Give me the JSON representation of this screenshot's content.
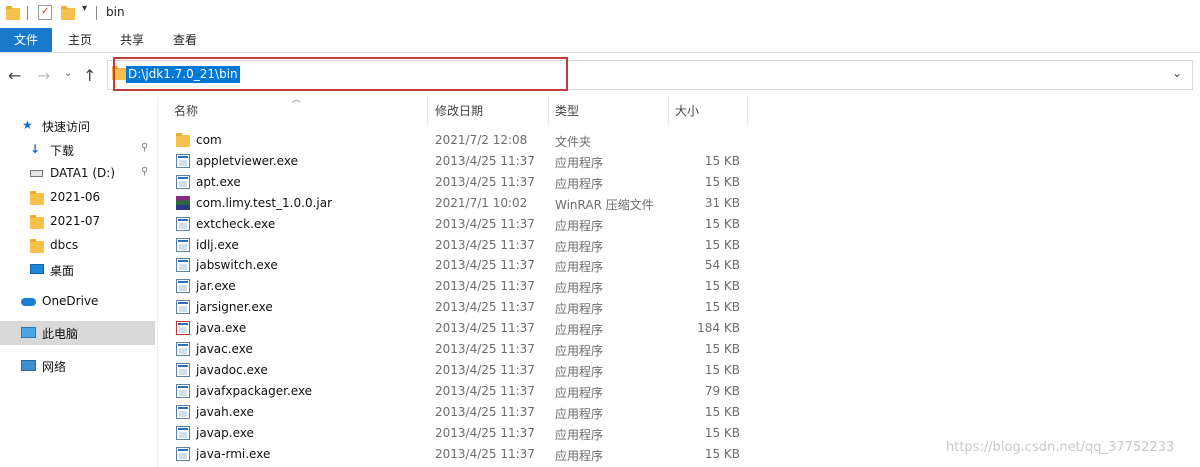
{
  "window": {
    "title": "bin"
  },
  "ribbon": {
    "tabs": [
      "文件",
      "主页",
      "共享",
      "查看"
    ]
  },
  "address": {
    "path": "D:\\jdk1.7.0_21\\bin"
  },
  "sidebar": {
    "items": [
      {
        "label": "快速访问",
        "icon": "star-icon"
      },
      {
        "label": "下载",
        "icon": "download-icon",
        "pinned": true
      },
      {
        "label": "DATA1 (D:)",
        "icon": "drive-icon",
        "pinned": true
      },
      {
        "label": "2021-06",
        "icon": "folder-icon"
      },
      {
        "label": "2021-07",
        "icon": "folder-icon"
      },
      {
        "label": "dbcs",
        "icon": "folder-icon"
      },
      {
        "label": "桌面",
        "icon": "desktop-icon"
      },
      {
        "label": "OneDrive",
        "icon": "cloud-icon"
      },
      {
        "label": "此电脑",
        "icon": "computer-icon",
        "selected": true
      },
      {
        "label": "网络",
        "icon": "network-icon"
      }
    ]
  },
  "columns": {
    "name": "名称",
    "date": "修改日期",
    "type": "类型",
    "size": "大小"
  },
  "files": [
    {
      "name": "com",
      "date": "2021/7/2 12:08",
      "type": "文件夹",
      "size": "",
      "icon": "folder"
    },
    {
      "name": "appletviewer.exe",
      "date": "2013/4/25 11:37",
      "type": "应用程序",
      "size": "15 KB",
      "icon": "exe"
    },
    {
      "name": "apt.exe",
      "date": "2013/4/25 11:37",
      "type": "应用程序",
      "size": "15 KB",
      "icon": "exe"
    },
    {
      "name": "com.limy.test_1.0.0.jar",
      "date": "2021/7/1 10:02",
      "type": "WinRAR 压缩文件",
      "size": "31 KB",
      "icon": "rar"
    },
    {
      "name": "extcheck.exe",
      "date": "2013/4/25 11:37",
      "type": "应用程序",
      "size": "15 KB",
      "icon": "exe"
    },
    {
      "name": "idlj.exe",
      "date": "2013/4/25 11:37",
      "type": "应用程序",
      "size": "15 KB",
      "icon": "exe"
    },
    {
      "name": "jabswitch.exe",
      "date": "2013/4/25 11:37",
      "type": "应用程序",
      "size": "54 KB",
      "icon": "exe"
    },
    {
      "name": "jar.exe",
      "date": "2013/4/25 11:37",
      "type": "应用程序",
      "size": "15 KB",
      "icon": "exe"
    },
    {
      "name": "jarsigner.exe",
      "date": "2013/4/25 11:37",
      "type": "应用程序",
      "size": "15 KB",
      "icon": "exe"
    },
    {
      "name": "java.exe",
      "date": "2013/4/25 11:37",
      "type": "应用程序",
      "size": "184 KB",
      "icon": "java"
    },
    {
      "name": "javac.exe",
      "date": "2013/4/25 11:37",
      "type": "应用程序",
      "size": "15 KB",
      "icon": "exe"
    },
    {
      "name": "javadoc.exe",
      "date": "2013/4/25 11:37",
      "type": "应用程序",
      "size": "15 KB",
      "icon": "exe"
    },
    {
      "name": "javafxpackager.exe",
      "date": "2013/4/25 11:37",
      "type": "应用程序",
      "size": "79 KB",
      "icon": "exe"
    },
    {
      "name": "javah.exe",
      "date": "2013/4/25 11:37",
      "type": "应用程序",
      "size": "15 KB",
      "icon": "exe"
    },
    {
      "name": "javap.exe",
      "date": "2013/4/25 11:37",
      "type": "应用程序",
      "size": "15 KB",
      "icon": "exe"
    },
    {
      "name": "java-rmi.exe",
      "date": "2013/4/25 11:37",
      "type": "应用程序",
      "size": "15 KB",
      "icon": "exe"
    }
  ],
  "watermark": "https://blog.csdn.net/qq_37752233",
  "colors": {
    "accent": "#1979ca",
    "selection": "#0078d7",
    "highlight_box": "#c43c3c",
    "folder": "#f6c04a"
  }
}
